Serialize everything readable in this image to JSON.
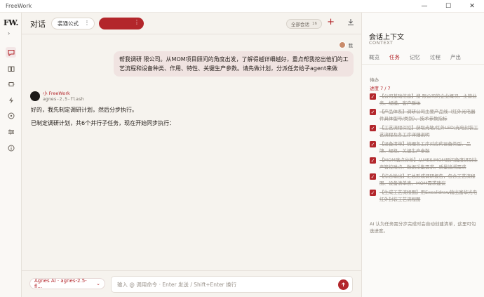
{
  "app": {
    "title": "FreeWork",
    "logo": "FW."
  },
  "window": {
    "minimize": "—",
    "maximize": "☐",
    "close": "✕"
  },
  "rail": {
    "icons": [
      "chat-icon",
      "book-icon",
      "puzzle-icon",
      "bolt-icon",
      "compass-icon",
      "sliders-icon",
      "info-icon"
    ]
  },
  "header": {
    "title": "对话",
    "tag1": "装通公式",
    "tag2": "",
    "all_conversations": "全部会话",
    "all_conversations_count": "16"
  },
  "messages": {
    "user_label": "我",
    "user_text": "帮我调研                        限公司。从MOM项目顾问的角度出发，了解得越详细越好，重点帮我挖出他们的工艺流程和设备种类、作用、特性、关键生产参数。请先做计划，分派任务给子agent来做",
    "bot_name": "小 FreeWork",
    "bot_model": "agnes-2.5-flash",
    "bot_line1": "好的，我先制定调研计划，然后分步执行。",
    "bot_line2": "已制定调研计划，共6个并行子任务，现在开始同步执行："
  },
  "input": {
    "model": "Agnes AI · agnes-2.5-fl...",
    "placeholder": "输入 @ 调用命令 · Enter 发送 / Shift+Enter 换行"
  },
  "panel": {
    "title": "会话上下文",
    "subtitle": "CONTEXT",
    "tabs": [
      "概览",
      "任务",
      "记忆",
      "过程",
      "产出"
    ],
    "active_tab": 1,
    "section": "待办",
    "progress": "进度 7 / 7",
    "tasks": [
      "【公司基础信息】搜                    限公司的企业概况、主营业务、规模、客户群体",
      "【产品体系】调研公司主要产品线（红外光电器件具体型号/类别）、技术参数指标",
      "【工艺流程深挖】获取光敏/红外LED/光电封装工艺流程及各工序详细说明",
      "【设备清单】梳理各工序对应的设备类型、品牌、规格、关键生产参数",
      "【MOM痛点分析】从MES/MOM顾问角度识别生产管控难点、数据采集需求、质量追溯需求",
      "【综合输出】汇总形成调研报告，包含工艺流程图、设备清单表、MOM需求建议",
      "【生成工艺流程图】用Excalidraw输出富华光电红外封装工艺流程图"
    ],
    "note": "AI 认为任务需分步完成时会自动创建清单，这里可勾选进度。"
  },
  "colors": {
    "accent": "#b3262b",
    "bubble": "#f0e3e1"
  }
}
